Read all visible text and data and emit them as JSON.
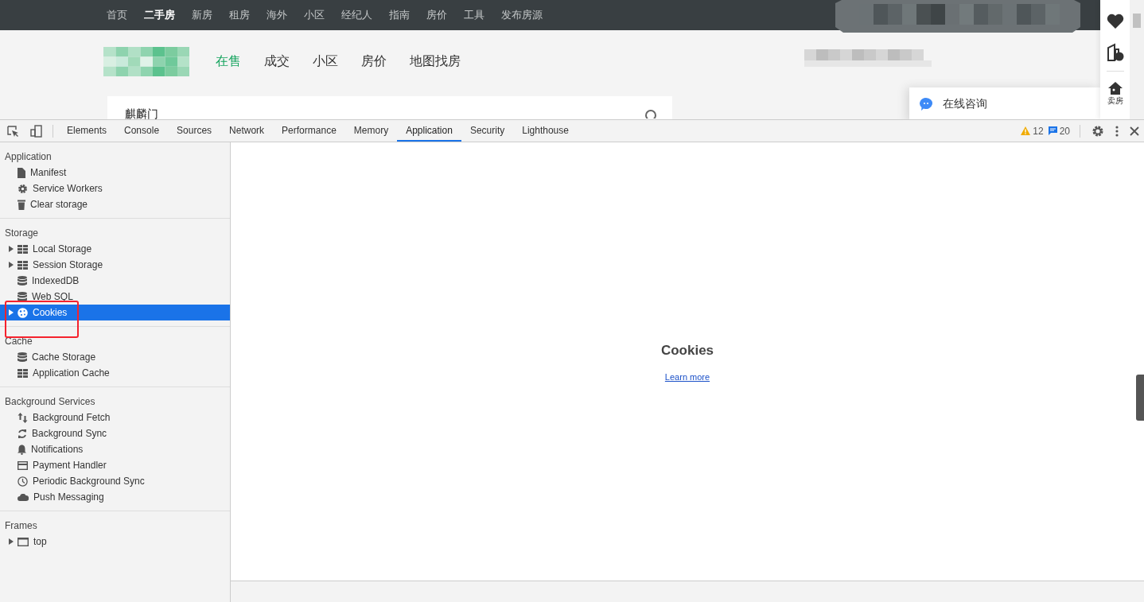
{
  "site": {
    "top_nav": [
      {
        "label": "首页",
        "selected": false
      },
      {
        "label": "二手房",
        "selected": true
      },
      {
        "label": "新房",
        "selected": false
      },
      {
        "label": "租房",
        "selected": false
      },
      {
        "label": "海外",
        "selected": false
      },
      {
        "label": "小区",
        "selected": false
      },
      {
        "label": "经纪人",
        "selected": false
      },
      {
        "label": "指南",
        "selected": false
      },
      {
        "label": "房价",
        "selected": false
      },
      {
        "label": "工具",
        "selected": false
      },
      {
        "label": "发布房源",
        "selected": false
      }
    ],
    "main_nav": [
      {
        "label": "在售",
        "selected": true
      },
      {
        "label": "成交",
        "selected": false
      },
      {
        "label": "小区",
        "selected": false
      },
      {
        "label": "房价",
        "selected": false
      },
      {
        "label": "地图找房",
        "selected": false
      }
    ],
    "search": {
      "value": "麒麟门"
    },
    "chat": {
      "label": "在线咨询"
    },
    "side_tools": [
      {
        "kind": "favorite"
      },
      {
        "kind": "compare"
      },
      {
        "kind": "sell",
        "label": "卖房"
      }
    ]
  },
  "devtools": {
    "tabs": [
      {
        "label": "Elements",
        "selected": false
      },
      {
        "label": "Console",
        "selected": false
      },
      {
        "label": "Sources",
        "selected": false
      },
      {
        "label": "Network",
        "selected": false
      },
      {
        "label": "Performance",
        "selected": false
      },
      {
        "label": "Memory",
        "selected": false
      },
      {
        "label": "Application",
        "selected": true
      },
      {
        "label": "Security",
        "selected": false
      },
      {
        "label": "Lighthouse",
        "selected": false
      }
    ],
    "warnings": "12",
    "messages": "20",
    "sidebar": [
      {
        "title": "Application",
        "items": [
          {
            "label": "Manifest",
            "kind": "file",
            "expandable": false,
            "selected": false
          },
          {
            "label": "Service Workers",
            "kind": "gear",
            "expandable": false,
            "selected": false
          },
          {
            "label": "Clear storage",
            "kind": "trash",
            "expandable": false,
            "selected": false
          }
        ]
      },
      {
        "title": "Storage",
        "items": [
          {
            "label": "Local Storage",
            "kind": "grid",
            "expandable": true,
            "selected": false
          },
          {
            "label": "Session Storage",
            "kind": "grid",
            "expandable": true,
            "selected": false
          },
          {
            "label": "IndexedDB",
            "kind": "db",
            "expandable": false,
            "selected": false
          },
          {
            "label": "Web SQL",
            "kind": "db",
            "expandable": false,
            "selected": false
          },
          {
            "label": "Cookies",
            "kind": "cookie",
            "expandable": true,
            "selected": true
          }
        ]
      },
      {
        "title": "Cache",
        "items": [
          {
            "label": "Cache Storage",
            "kind": "db",
            "expandable": false,
            "selected": false
          },
          {
            "label": "Application Cache",
            "kind": "grid",
            "expandable": false,
            "selected": false
          }
        ]
      },
      {
        "title": "Background Services",
        "items": [
          {
            "label": "Background Fetch",
            "kind": "arrows",
            "expandable": false,
            "selected": false
          },
          {
            "label": "Background Sync",
            "kind": "sync",
            "expandable": false,
            "selected": false
          },
          {
            "label": "Notifications",
            "kind": "bell",
            "expandable": false,
            "selected": false
          },
          {
            "label": "Payment Handler",
            "kind": "card",
            "expandable": false,
            "selected": false
          },
          {
            "label": "Periodic Background Sync",
            "kind": "clock",
            "expandable": false,
            "selected": false
          },
          {
            "label": "Push Messaging",
            "kind": "cloud",
            "expandable": false,
            "selected": false
          }
        ]
      },
      {
        "title": "Frames",
        "items": [
          {
            "label": "top",
            "kind": "frame",
            "expandable": true,
            "selected": false
          }
        ]
      }
    ],
    "panel": {
      "title": "Cookies",
      "link": "Learn more"
    }
  },
  "annotation": {
    "kind": "rectangle"
  }
}
